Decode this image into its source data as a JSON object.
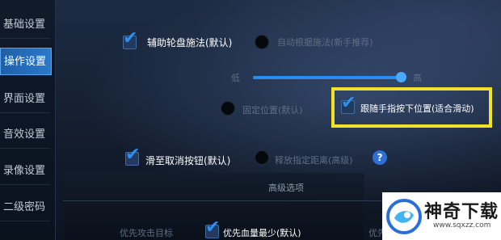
{
  "sidebar": {
    "items": [
      {
        "label": "基础设置"
      },
      {
        "label": "操作设置"
      },
      {
        "label": "界面设置"
      },
      {
        "label": "音效设置"
      },
      {
        "label": "录像设置"
      },
      {
        "label": "二级密码"
      }
    ],
    "active_index": 1
  },
  "sections": {
    "top": "",
    "cancel": "",
    "advanced": "高级选项"
  },
  "options": {
    "assist_wheel": "辅助轮盘施法(默认)",
    "auto_novice": "自动根据施法(新手推荐)",
    "sensitivity_label": "",
    "slider_low": "低",
    "slider_high": "高",
    "slider_value_percent": 98,
    "skill_row_label": "",
    "fixed_position": "固定位置(默认)",
    "follow_finger": "跟随手指按下位置(适合滑动)",
    "slide_cancel": "滑至取消按钮(默认)",
    "release_cancel": "释放指定距离(高级)",
    "priority_label": "优先攻击目标",
    "priority_lowest_hp": "优先血量最少(默认)",
    "priority_other": "优先"
  },
  "help": {
    "glyph": "?"
  },
  "watermark": {
    "title": "神奇下载",
    "url": "www.sqxzz.com"
  },
  "colors": {
    "highlight": "#f2e12a",
    "accent": "#2e8ff0"
  }
}
